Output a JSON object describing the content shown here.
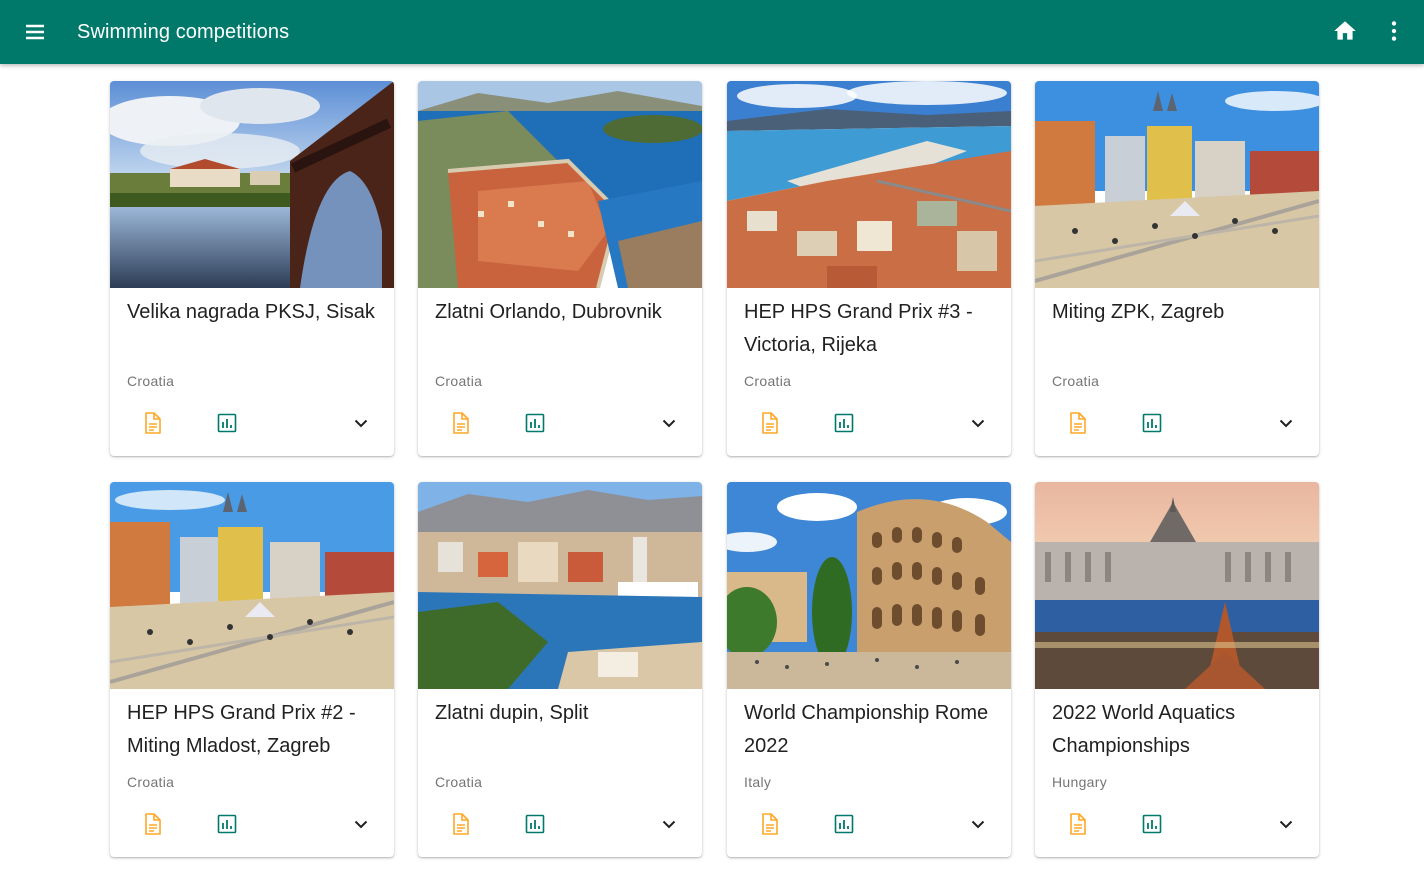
{
  "appbar": {
    "title": "Swimming competitions",
    "menu_icon": "menu-icon",
    "home_icon": "home-icon",
    "more_icon": "more-vert-icon",
    "color": "#00796b"
  },
  "colors": {
    "doc_icon": "#ffa726",
    "stats_icon": "#00796b",
    "expand_icon": "#212121"
  },
  "competitions": [
    {
      "title": "Velika nagrada PKSJ, Sisak",
      "country": "Croatia",
      "image": "river-bridge-town"
    },
    {
      "title": "Zlatni Orlando, Dubrovnik",
      "country": "Croatia",
      "image": "dubrovnik-old-town"
    },
    {
      "title": "HEP HPS Grand Prix #3 - Victoria, Rijeka",
      "country": "Croatia",
      "image": "rijeka-harbour"
    },
    {
      "title": "Miting ZPK, Zagreb",
      "country": "Croatia",
      "image": "zagreb-square"
    },
    {
      "title": "HEP HPS Grand Prix #2 - Miting Mladost, Zagreb",
      "country": "Croatia",
      "image": "zagreb-square"
    },
    {
      "title": "Zlatni dupin, Split",
      "country": "Croatia",
      "image": "split-harbour"
    },
    {
      "title": "World Championship Rome 2022",
      "country": "Italy",
      "image": "rome-colosseum"
    },
    {
      "title": "2022 World Aquatics Championships",
      "country": "Hungary",
      "image": "budapest-parliament"
    }
  ]
}
